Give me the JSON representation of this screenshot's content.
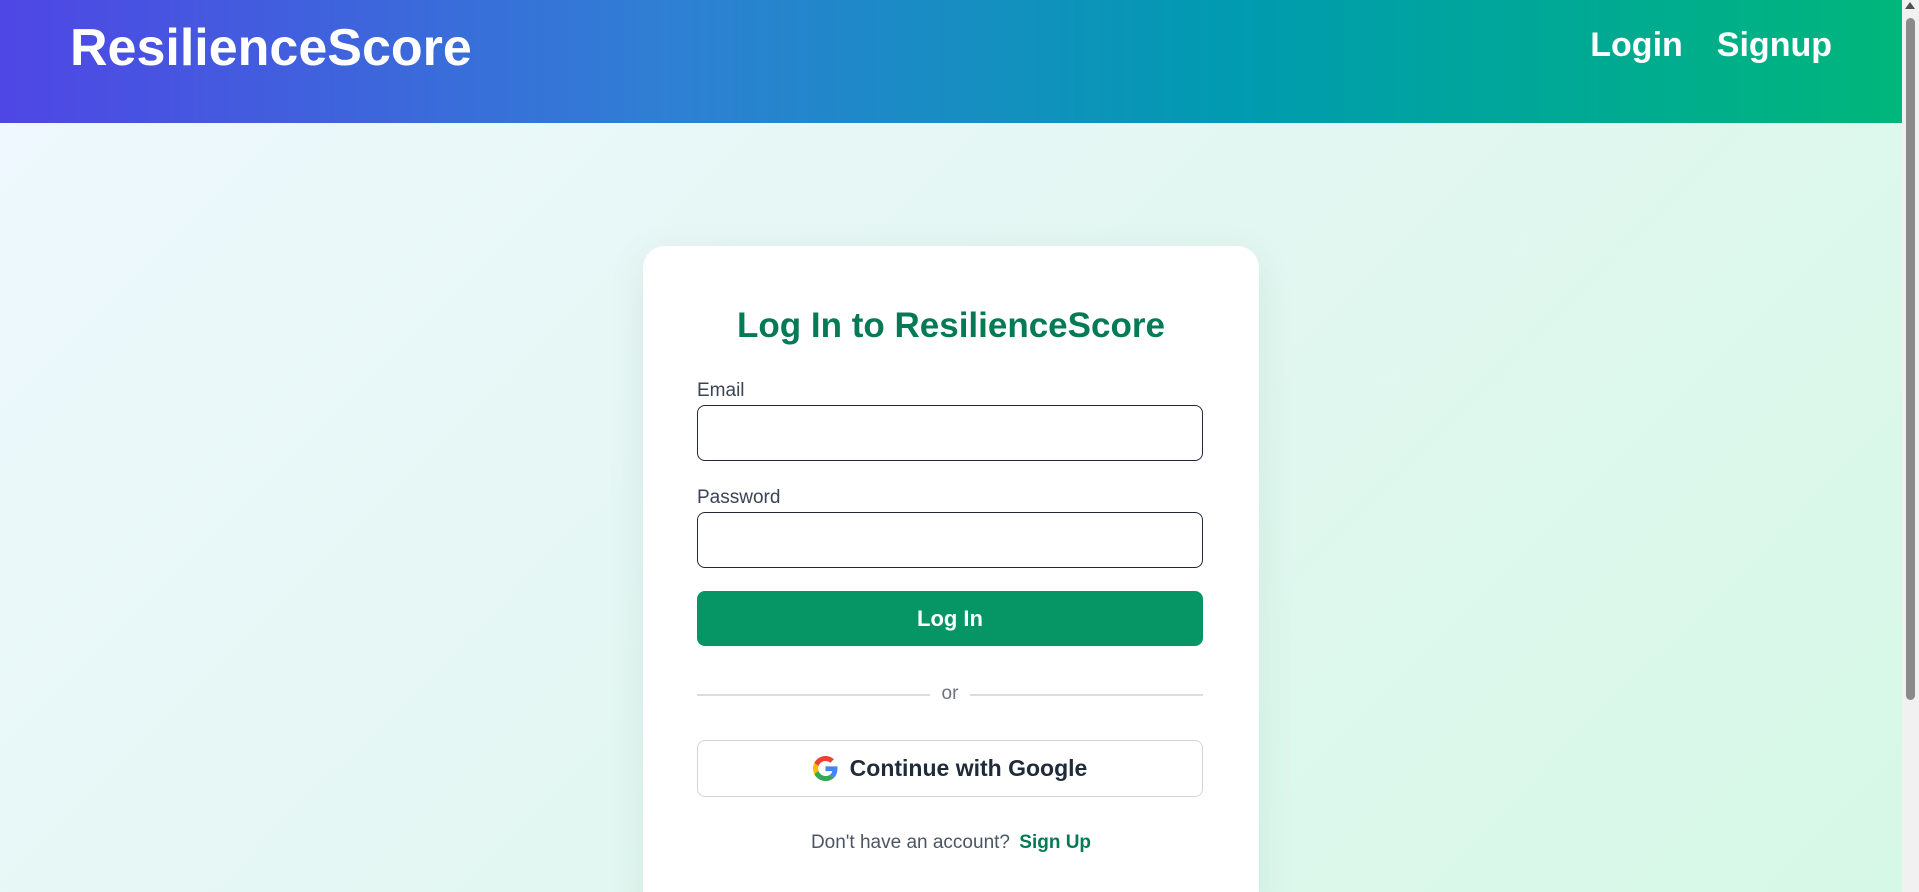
{
  "header": {
    "brand": "ResilienceScore",
    "nav": {
      "login": "Login",
      "signup": "Signup"
    }
  },
  "login_card": {
    "title": "Log In to ResilienceScore",
    "email": {
      "label": "Email",
      "value": "",
      "placeholder": ""
    },
    "password": {
      "label": "Password",
      "value": "",
      "placeholder": ""
    },
    "submit_label": "Log In",
    "divider_text": "or",
    "google_label": "Continue with Google",
    "google_icon": "google-icon",
    "footer_prompt": "Don't have an account?",
    "footer_link": "Sign Up"
  },
  "colors": {
    "accent": "#069665",
    "title": "#067a55",
    "header_gradient_start": "#4f46e5",
    "header_gradient_end": "#00b67a"
  }
}
